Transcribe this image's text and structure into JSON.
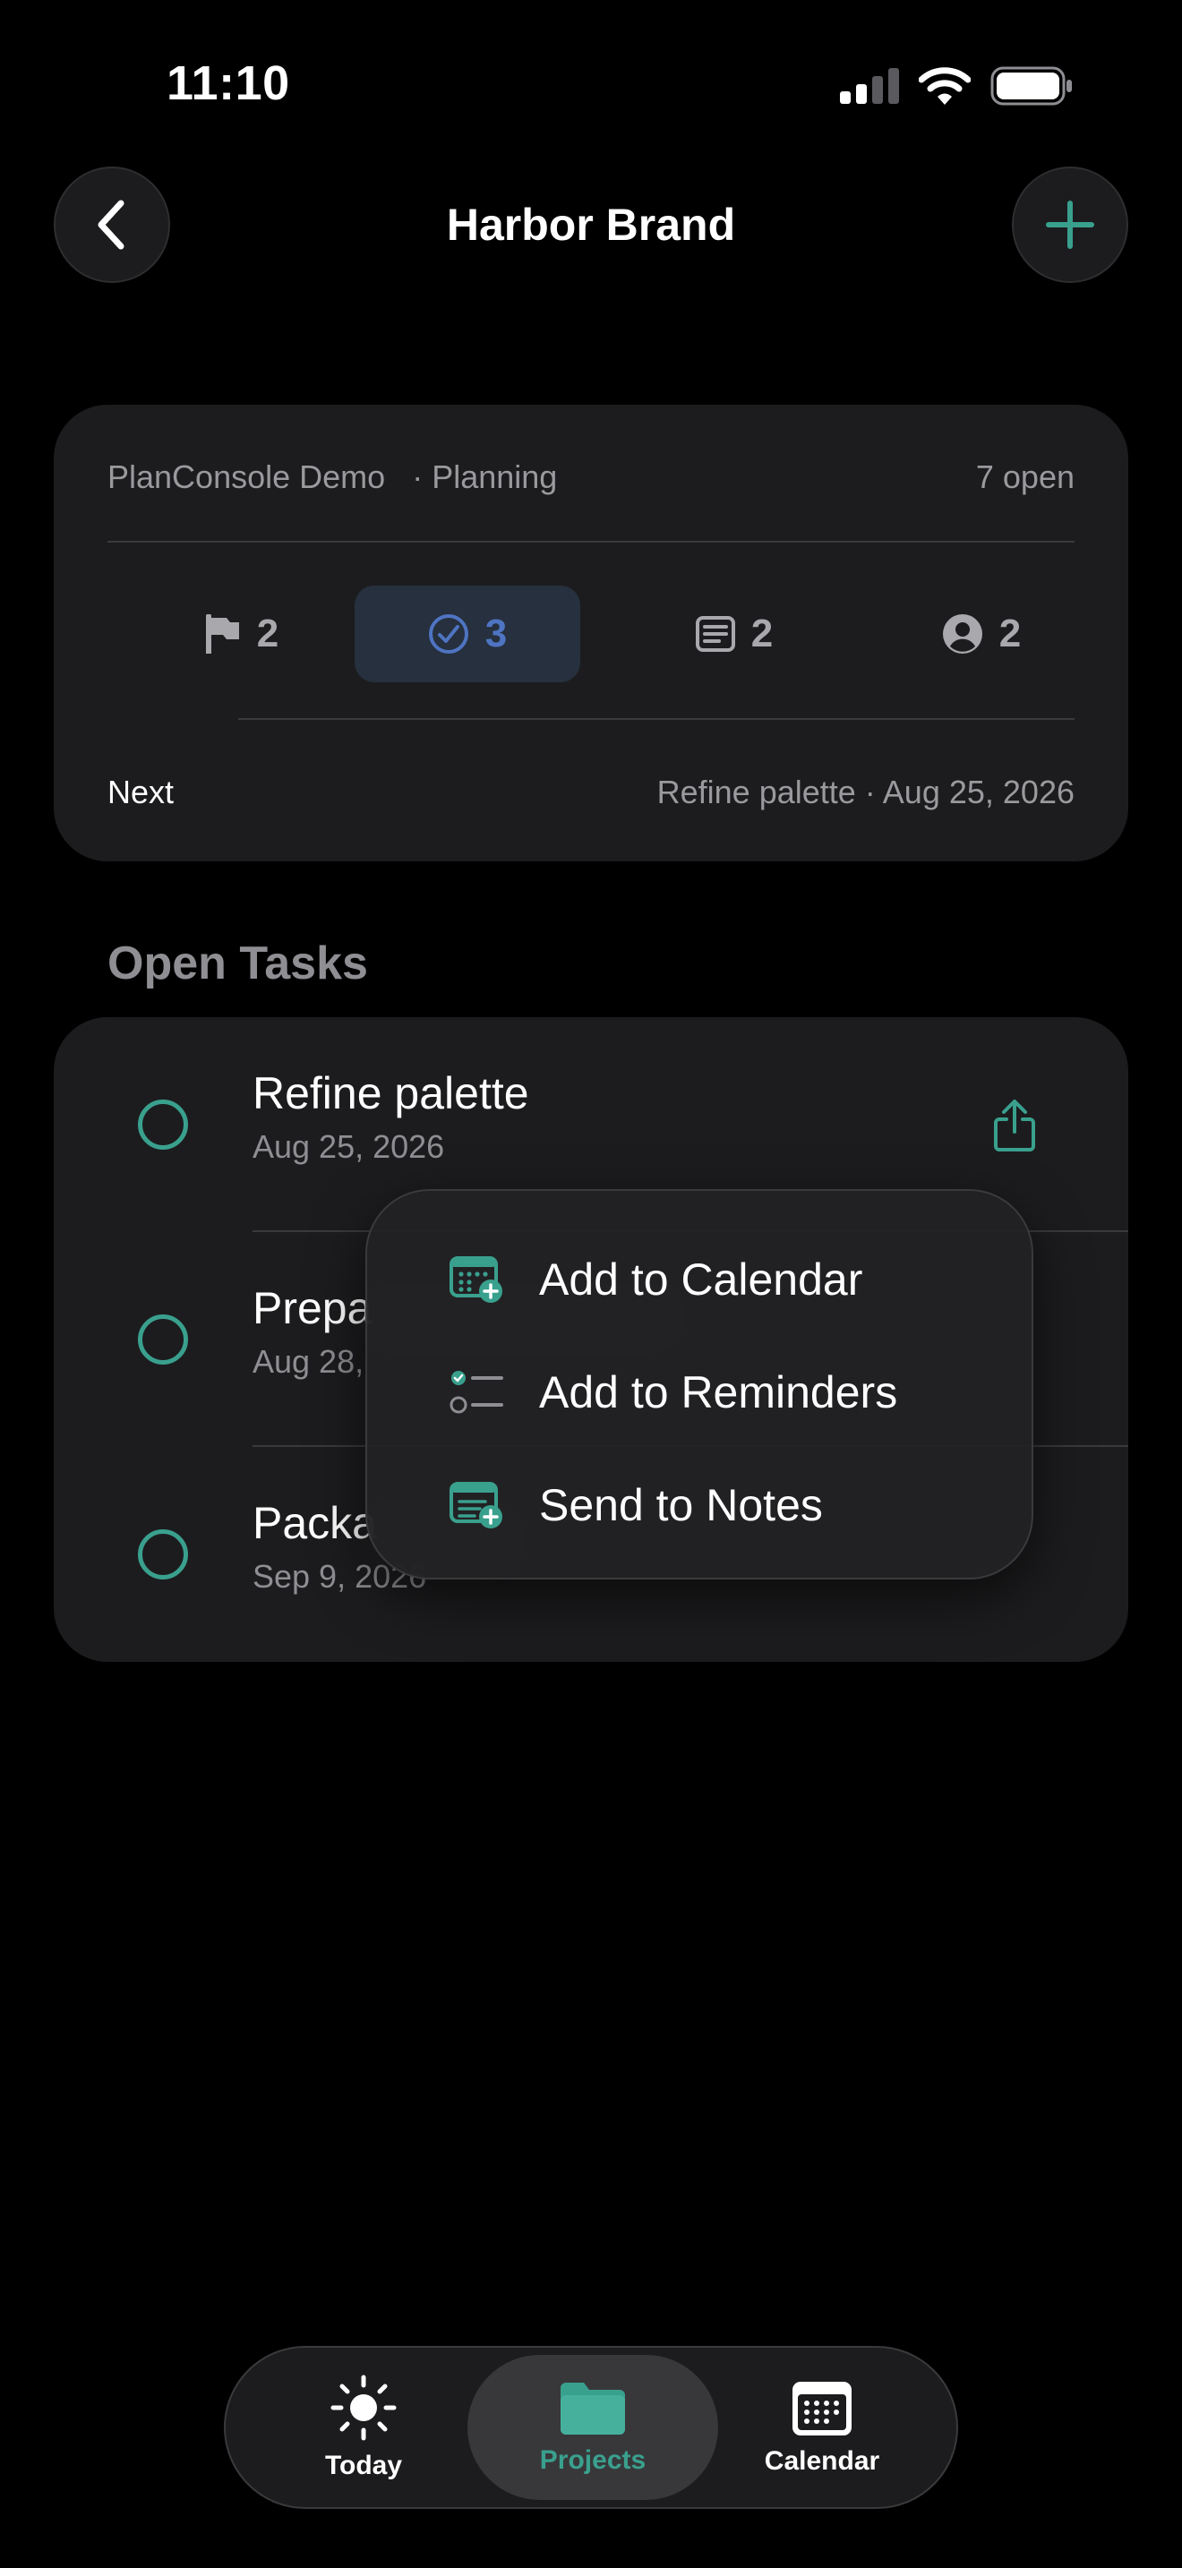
{
  "status_bar": {
    "time": "11:10"
  },
  "nav": {
    "title": "Harbor Brand"
  },
  "summary": {
    "workspace": "PlanConsole Demo",
    "phase": "· Planning",
    "open_count": "7 open",
    "stats": [
      {
        "icon": "flag-icon",
        "value": "2"
      },
      {
        "icon": "checkmark-circle-icon",
        "value": "3",
        "active": true
      },
      {
        "icon": "note-icon",
        "value": "2"
      },
      {
        "icon": "person-circle-icon",
        "value": "2"
      }
    ],
    "next_label": "Next",
    "next_value": "Refine palette · Aug 25, 2026"
  },
  "open_tasks": {
    "title": "Open Tasks",
    "items": [
      {
        "title": "Refine palette",
        "date": "Aug 25, 2026"
      },
      {
        "title": "Prepa",
        "date": "Aug 28,"
      },
      {
        "title": "Packa",
        "date": "Sep 9, 2026"
      }
    ]
  },
  "menu": {
    "items": [
      {
        "label": "Add to Calendar",
        "icon": "calendar-add-icon"
      },
      {
        "label": "Add to Reminders",
        "icon": "checklist-icon"
      },
      {
        "label": "Send to Notes",
        "icon": "note-add-icon"
      }
    ]
  },
  "tabbar": {
    "tabs": [
      {
        "label": "Today",
        "icon": "sun-icon"
      },
      {
        "label": "Projects",
        "icon": "folder-icon",
        "active": true
      },
      {
        "label": "Calendar",
        "icon": "calendar-icon"
      }
    ]
  },
  "colors": {
    "accent": "#3aa08e",
    "selected_stat": "#4e74c2",
    "card": "#1c1c1e"
  }
}
